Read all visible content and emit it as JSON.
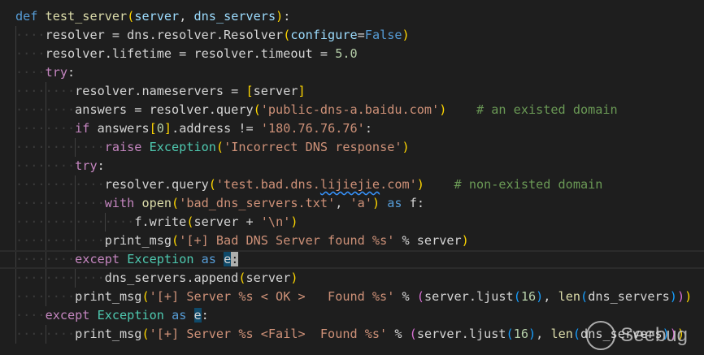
{
  "colors": {
    "background": "#1e1e1e",
    "keyword": "#569cd6",
    "control": "#c586c0",
    "function": "#dcdcaa",
    "string": "#ce9178",
    "number": "#b5cea8",
    "comment": "#6a9955",
    "class": "#4ec9b0"
  },
  "lines": [
    {
      "indent": 0,
      "tokens": [
        [
          "def",
          "kw"
        ],
        [
          " ",
          ""
        ],
        [
          "test_server",
          "fn"
        ],
        [
          "(",
          "b1"
        ],
        [
          "server",
          "param"
        ],
        [
          ", ",
          ""
        ],
        [
          "dns_servers",
          "param"
        ],
        [
          ")",
          "b1"
        ],
        [
          ":",
          ""
        ]
      ]
    },
    {
      "indent": 4,
      "tokens": [
        [
          "resolver = dns.resolver.Resolver",
          ""
        ],
        [
          "(",
          "b1"
        ],
        [
          "configure",
          "param"
        ],
        [
          "=",
          ""
        ],
        [
          "False",
          "kw"
        ],
        [
          ")",
          "b1"
        ]
      ]
    },
    {
      "indent": 4,
      "tokens": [
        [
          "resolver.lifetime = resolver.timeout = ",
          ""
        ],
        [
          "5.0",
          "num"
        ]
      ]
    },
    {
      "indent": 4,
      "tokens": [
        [
          "try",
          "ctrl"
        ],
        [
          ":",
          ""
        ]
      ]
    },
    {
      "indent": 8,
      "tokens": [
        [
          "resolver.nameservers = ",
          ""
        ],
        [
          "[",
          "b1"
        ],
        [
          "server",
          ""
        ],
        [
          "]",
          "b1"
        ]
      ]
    },
    {
      "indent": 8,
      "tokens": [
        [
          "answers = resolver.query",
          ""
        ],
        [
          "(",
          "b1"
        ],
        [
          "'public-dns-a.baidu.com'",
          "str"
        ],
        [
          ")",
          "b1"
        ],
        [
          "    ",
          ""
        ],
        [
          "# an existed domain",
          "cmt"
        ]
      ]
    },
    {
      "indent": 8,
      "tokens": [
        [
          "if",
          "ctrl"
        ],
        [
          " answers",
          ""
        ],
        [
          "[",
          "b1"
        ],
        [
          "0",
          "num"
        ],
        [
          "]",
          "b1"
        ],
        [
          ".address != ",
          ""
        ],
        [
          "'180.76.76.76'",
          "str"
        ],
        [
          ":",
          ""
        ]
      ]
    },
    {
      "indent": 12,
      "tokens": [
        [
          "raise",
          "ctrl"
        ],
        [
          " ",
          ""
        ],
        [
          "Exception",
          "cls"
        ],
        [
          "(",
          "b1"
        ],
        [
          "'Incorrect DNS response'",
          "str"
        ],
        [
          ")",
          "b1"
        ]
      ]
    },
    {
      "indent": 8,
      "tokens": [
        [
          "try",
          "ctrl"
        ],
        [
          ":",
          ""
        ]
      ]
    },
    {
      "indent": 12,
      "tokens": [
        [
          "resolver.query",
          ""
        ],
        [
          "(",
          "b1"
        ],
        [
          "'test.bad.dns.",
          "str"
        ],
        [
          "lijiejie",
          "str squig"
        ],
        [
          ".com'",
          "str"
        ],
        [
          ")",
          "b1"
        ],
        [
          "    ",
          ""
        ],
        [
          "# non-existed domain",
          "cmt"
        ]
      ]
    },
    {
      "indent": 12,
      "tokens": [
        [
          "with",
          "ctrl"
        ],
        [
          " ",
          ""
        ],
        [
          "open",
          "fn"
        ],
        [
          "(",
          "b1"
        ],
        [
          "'bad_dns_servers.txt'",
          "str"
        ],
        [
          ", ",
          ""
        ],
        [
          "'a'",
          "str"
        ],
        [
          ")",
          "b1"
        ],
        [
          " ",
          ""
        ],
        [
          "as",
          "kw"
        ],
        [
          " f:",
          ""
        ]
      ]
    },
    {
      "indent": 16,
      "tokens": [
        [
          "f.write",
          ""
        ],
        [
          "(",
          "b1"
        ],
        [
          "server + ",
          ""
        ],
        [
          "'\\n'",
          "str"
        ],
        [
          ")",
          "b1"
        ]
      ]
    },
    {
      "indent": 12,
      "tokens": [
        [
          "print_msg",
          ""
        ],
        [
          "(",
          "b1"
        ],
        [
          "'[+] Bad DNS Server found %s'",
          "str"
        ],
        [
          " % server",
          ""
        ],
        [
          ")",
          "b1"
        ]
      ]
    },
    {
      "indent": 8,
      "current": true,
      "tokens": [
        [
          "except",
          "ctrl"
        ],
        [
          " ",
          ""
        ],
        [
          "Exception",
          "cls"
        ],
        [
          " ",
          ""
        ],
        [
          "as",
          "kw"
        ],
        [
          " ",
          ""
        ],
        [
          "e",
          "sel"
        ],
        [
          ":",
          "cursor"
        ]
      ]
    },
    {
      "indent": 12,
      "tokens": [
        [
          "dns_servers.append",
          ""
        ],
        [
          "(",
          "b1"
        ],
        [
          "server",
          ""
        ],
        [
          ")",
          "b1"
        ]
      ]
    },
    {
      "indent": 8,
      "tokens": [
        [
          "print_msg",
          ""
        ],
        [
          "(",
          "b1"
        ],
        [
          "'[+] Server %s < OK >   Found %s'",
          "str"
        ],
        [
          " % ",
          ""
        ],
        [
          "(",
          "b2"
        ],
        [
          "server.ljust",
          ""
        ],
        [
          "(",
          "b3"
        ],
        [
          "16",
          "num"
        ],
        [
          ")",
          "b3"
        ],
        [
          ", ",
          ""
        ],
        [
          "len",
          "fn"
        ],
        [
          "(",
          "b3"
        ],
        [
          "dns_servers",
          ""
        ],
        [
          ")",
          "b3"
        ],
        [
          ")",
          "b2"
        ],
        [
          ")",
          "b1"
        ]
      ]
    },
    {
      "indent": 4,
      "tokens": [
        [
          "except",
          "ctrl"
        ],
        [
          " ",
          ""
        ],
        [
          "Exception",
          "cls"
        ],
        [
          " ",
          ""
        ],
        [
          "as",
          "kw"
        ],
        [
          " ",
          ""
        ],
        [
          "e",
          "sel"
        ],
        [
          ":",
          ""
        ]
      ]
    },
    {
      "indent": 8,
      "tokens": [
        [
          "print_msg",
          ""
        ],
        [
          "(",
          "b1"
        ],
        [
          "'[+] Server %s <Fail>  Found %s'",
          "str"
        ],
        [
          " % ",
          ""
        ],
        [
          "(",
          "b2"
        ],
        [
          "server.ljust",
          ""
        ],
        [
          "(",
          "b3"
        ],
        [
          "16",
          "num"
        ],
        [
          ")",
          "b3"
        ],
        [
          ", ",
          ""
        ],
        [
          "len",
          "fn"
        ],
        [
          "(",
          "b3"
        ],
        [
          "dns_servers",
          ""
        ],
        [
          ")",
          "b3"
        ],
        [
          ")",
          "b2"
        ],
        [
          ")",
          "b1"
        ]
      ]
    }
  ],
  "watermark": {
    "text": "Seebug"
  }
}
